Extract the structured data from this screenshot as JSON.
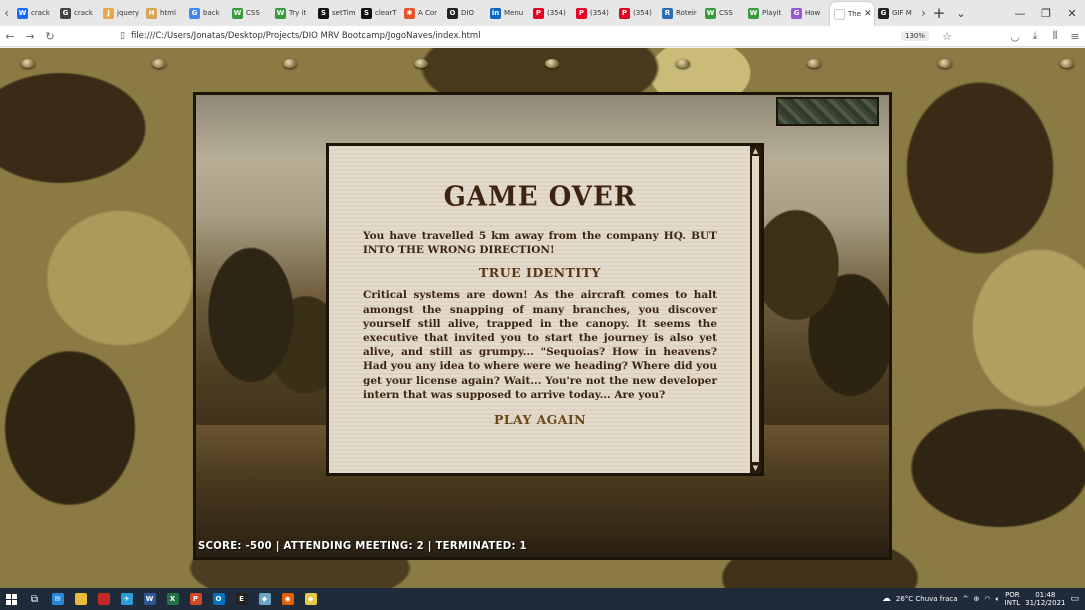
{
  "browser": {
    "tabs": [
      {
        "label": "crack",
        "icon": "W",
        "color": "#1769ff"
      },
      {
        "label": "crack",
        "icon": "G",
        "color": "#444"
      },
      {
        "label": "jquery",
        "icon": "J",
        "color": "#e8a84a"
      },
      {
        "label": "html",
        "icon": "H",
        "color": "#d9a45a"
      },
      {
        "label": "back",
        "icon": "G",
        "color": "#4285f4"
      },
      {
        "label": "CSS",
        "icon": "W",
        "color": "#3a9a3a"
      },
      {
        "label": "Try it",
        "icon": "W",
        "color": "#3a9a3a"
      },
      {
        "label": "setTim",
        "icon": "S",
        "color": "#111"
      },
      {
        "label": "clearT",
        "icon": "S",
        "color": "#111"
      },
      {
        "label": "A Cor",
        "icon": "✱",
        "color": "#e0562c"
      },
      {
        "label": "DIO",
        "icon": "O",
        "color": "#222"
      },
      {
        "label": "Menu",
        "icon": "in",
        "color": "#0a66c2"
      },
      {
        "label": "(354)",
        "icon": "P",
        "color": "#e60023"
      },
      {
        "label": "(354)",
        "icon": "P",
        "color": "#e60023"
      },
      {
        "label": "(354)",
        "icon": "P",
        "color": "#e60023"
      },
      {
        "label": "Roteir",
        "icon": "R",
        "color": "#2a6bb5"
      },
      {
        "label": "CSS",
        "icon": "W",
        "color": "#3a9a3a"
      },
      {
        "label": "Playit",
        "icon": "W",
        "color": "#3a9a3a"
      },
      {
        "label": "How",
        "icon": "G",
        "color": "#9a56d8"
      },
      {
        "label": "The",
        "icon": "",
        "color": "#ffffff",
        "active": true
      },
      {
        "label": "GIF M",
        "icon": "G",
        "color": "#222"
      }
    ],
    "url": "file:///C:/Users/Jonatas/Desktop/Projects/DIO MRV Bootcamp/JogoNaves/index.html",
    "zoom": "130%"
  },
  "game": {
    "title": "GAME OVER",
    "intro": "You have travelled 5 km away from the company HQ. BUT INTO THE WRONG DIRECTION!",
    "subtitle": "TRUE IDENTITY",
    "story": "Critical systems are down! As the aircraft comes to halt amongst the snapping of many branches, you discover yourself still alive, trapped in the canopy. It seems the executive that invited you to start the journey is also yet alive, and still as grumpy... \"Sequoias? How in heavens? Had you any idea to where were we heading? Where did you get your license again? Wait... You're not the new developer intern that was supposed to arrive today... Are you?",
    "play_again": "PLAY AGAIN",
    "hud": "SCORE: -500 | ATTENDING MEETING: 2 | TERMINATED: 1"
  },
  "taskbar": {
    "weather": "26°C  Chuva fraca",
    "lang_top": "POR",
    "lang_bottom": "INTL",
    "time": "01:48",
    "date": "31/12/2021",
    "apps": [
      {
        "icon": "",
        "color": "#c62828"
      },
      {
        "icon": "✈",
        "color": "#2a9ed8"
      },
      {
        "icon": "W",
        "color": "#2b579a"
      },
      {
        "icon": "X",
        "color": "#217346"
      },
      {
        "icon": "P",
        "color": "#d24726"
      },
      {
        "icon": "O",
        "color": "#0072c6"
      },
      {
        "icon": "E",
        "color": "#222"
      },
      {
        "icon": "◆",
        "color": "#6aa6c8"
      },
      {
        "icon": "◉",
        "color": "#e66000"
      },
      {
        "icon": "◆",
        "color": "#e8c84a"
      }
    ]
  }
}
